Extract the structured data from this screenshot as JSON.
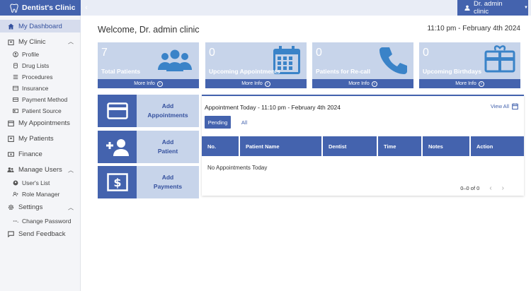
{
  "brand": {
    "name": "Dentist's Clinic",
    "logo_icon": "tooth-icon"
  },
  "topbar": {
    "collapse_icon": "chevron-left-icon",
    "user_name": "Dr. admin clinic",
    "user_icon": "person-icon"
  },
  "sidebar": {
    "dashboard": "My Dashboard",
    "my_clinic": "My Clinic",
    "clinic_items": [
      "Profile",
      "Drug Lists",
      "Procedures",
      "Insurance",
      "Payment Method",
      "Patient Source"
    ],
    "appointments": "My Appointments",
    "patients": "My Patients",
    "finance": "Finance",
    "manage_users": "Manage Users",
    "user_items": [
      "User's List",
      "Role Manager"
    ],
    "settings": "Settings",
    "settings_items": [
      "Change Password"
    ],
    "feedback": "Send Feedback"
  },
  "main": {
    "welcome": "Welcome, Dr. admin clinic",
    "datetime": "11:10 pm - February 4th 2024",
    "stats": [
      {
        "value": "7",
        "label": "Total Patients",
        "more": "More Info",
        "icon": "group-icon"
      },
      {
        "value": "0",
        "label": "Upcoming Appointments",
        "more": "More Info",
        "icon": "calendar-icon"
      },
      {
        "value": "0",
        "label": "Patients for Re-call",
        "more": "More Info",
        "icon": "phone-icon"
      },
      {
        "value": "0",
        "label": "Upcoming Birthdays",
        "more": "More Info",
        "icon": "gift-card-icon"
      }
    ],
    "actions": [
      {
        "line1": "Add",
        "line2": "Appointments",
        "icon": "card-icon"
      },
      {
        "line1": "Add",
        "line2": "Patient",
        "icon": "add-person-icon"
      },
      {
        "line1": "Add",
        "line2": "Payments",
        "icon": "dollar-icon"
      }
    ],
    "appointments": {
      "title": "Appointment Today - 11:10 pm - February 4th 2024",
      "view_all": "View All",
      "tabs": [
        "Pending",
        "All"
      ],
      "columns": [
        "No.",
        "Patient Name",
        "Dentist",
        "Time",
        "Notes",
        "Action"
      ],
      "empty": "No Appointments Today",
      "pagination": "0–0 of 0"
    }
  },
  "colors": {
    "primary": "#4463ae",
    "card_bg": "#c7d4ea",
    "sidebar_bg": "#f4f5f8"
  }
}
